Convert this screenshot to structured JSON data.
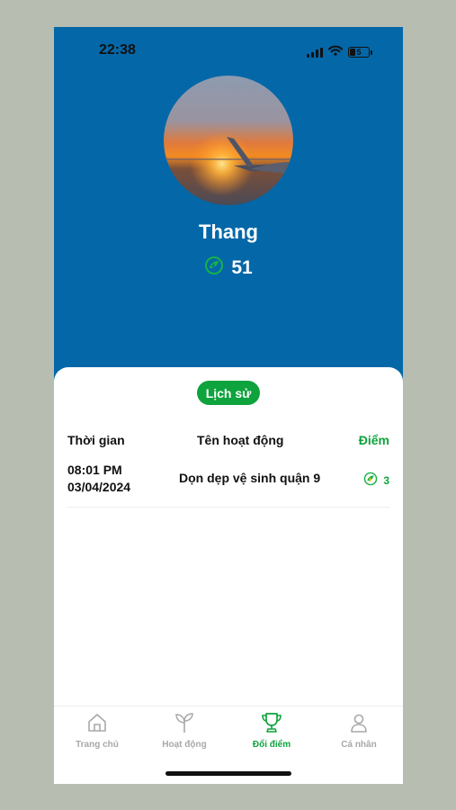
{
  "status_bar": {
    "time": "22:38",
    "battery_level": "5",
    "icons": [
      "signal-icon",
      "wifi-icon",
      "battery-icon"
    ]
  },
  "profile": {
    "name": "Thang",
    "points": "51",
    "avatar_icon": "sunset-airplane-wing-photo",
    "points_icon": "eco-leaf-bolt-icon"
  },
  "history": {
    "tab_label": "Lịch sử",
    "columns": {
      "time": "Thời gian",
      "activity": "Tên hoạt động",
      "points": "Điểm"
    },
    "rows": [
      {
        "time": "08:01 PM",
        "date": "03/04/2024",
        "activity": "Dọn dẹp vệ sinh quận 9",
        "points": "3"
      }
    ]
  },
  "tab_bar": {
    "items": [
      {
        "label": "Trang chủ",
        "icon": "home-icon",
        "active": false
      },
      {
        "label": "Hoạt động",
        "icon": "sprout-icon",
        "active": false
      },
      {
        "label": "Đổi điểm",
        "icon": "trophy-icon",
        "active": true
      },
      {
        "label": "Cá nhân",
        "icon": "person-icon",
        "active": false
      }
    ]
  },
  "colors": {
    "hero_blue": "#0467a8",
    "accent_green": "#0ea33c",
    "inactive_gray": "#a8a8a8",
    "page_bg": "#b8bdb2"
  }
}
